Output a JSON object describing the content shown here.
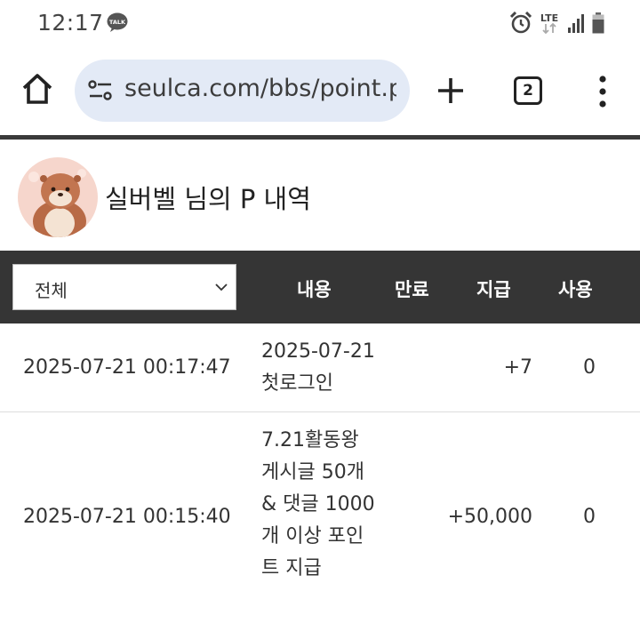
{
  "status_bar": {
    "time": "12:17",
    "icons": [
      "kakaotalk-icon",
      "alarm-icon",
      "lte-icon",
      "signal-icon",
      "battery-icon"
    ],
    "lte_label": "LTE"
  },
  "browser": {
    "url": "seulca.com/bbs/point.php",
    "tab_count": "2",
    "icons": [
      "home-icon",
      "site-settings-icon",
      "plus-icon",
      "more-vert-icon"
    ]
  },
  "profile": {
    "title": "실버벨 님의 P 내역"
  },
  "table": {
    "filter_value": "전체",
    "headers": {
      "content": "내용",
      "expire": "만료",
      "earned": "지급",
      "used": "사용"
    },
    "rows": [
      {
        "date": "2025-07-21 00:17:47",
        "content": "2025-07-21 첫로그인",
        "expire": "",
        "earned": "+7",
        "used": "0"
      },
      {
        "date": "2025-07-21 00:15:40",
        "content": "7.21활동왕 게시글 50개 & 댓글 1000개 이상 포인트 지급",
        "expire": "",
        "earned": "+50,000",
        "used": "0"
      }
    ]
  },
  "colors": {
    "header_bg": "#353535",
    "url_bar_bg": "#e3eaf6"
  }
}
